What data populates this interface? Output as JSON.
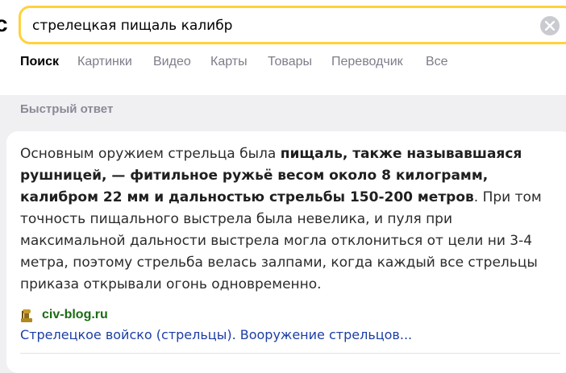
{
  "search": {
    "logo_fragment": "с",
    "query": "стрелецкая пищаль калибр"
  },
  "tabs": [
    {
      "label": "Поиск",
      "active": true
    },
    {
      "label": "Картинки"
    },
    {
      "label": "Видео"
    },
    {
      "label": "Карты"
    },
    {
      "label": "Товары"
    },
    {
      "label": "Переводчик"
    },
    {
      "label": "Все"
    }
  ],
  "quick_answer": {
    "section_label": "Быстрый ответ",
    "text_before": "Основным оружием стрельца была ",
    "text_bold": "пищаль, также называвшаяся рушницей, — фитильное ружьё весом около 8 килограмм, калибром 22 мм и дальностью стрельбы 150-200 метров",
    "text_after": ". При том точность пищального выстрела была невелика, и пуля при максимальной дальности выстрела могла отклониться от цели ни 3-4 метра, поэтому стрельба велась залпами, когда каждый все стрельцы приказа открывали огонь одновременно.",
    "source_domain": "civ-blog.ru",
    "source_title": "Стрелецкое войско (стрельцы). Вооружение стрельцов..."
  },
  "colors": {
    "accent": "#ffd23c",
    "link": "#1b3ea6",
    "domain": "#1b6b14"
  }
}
